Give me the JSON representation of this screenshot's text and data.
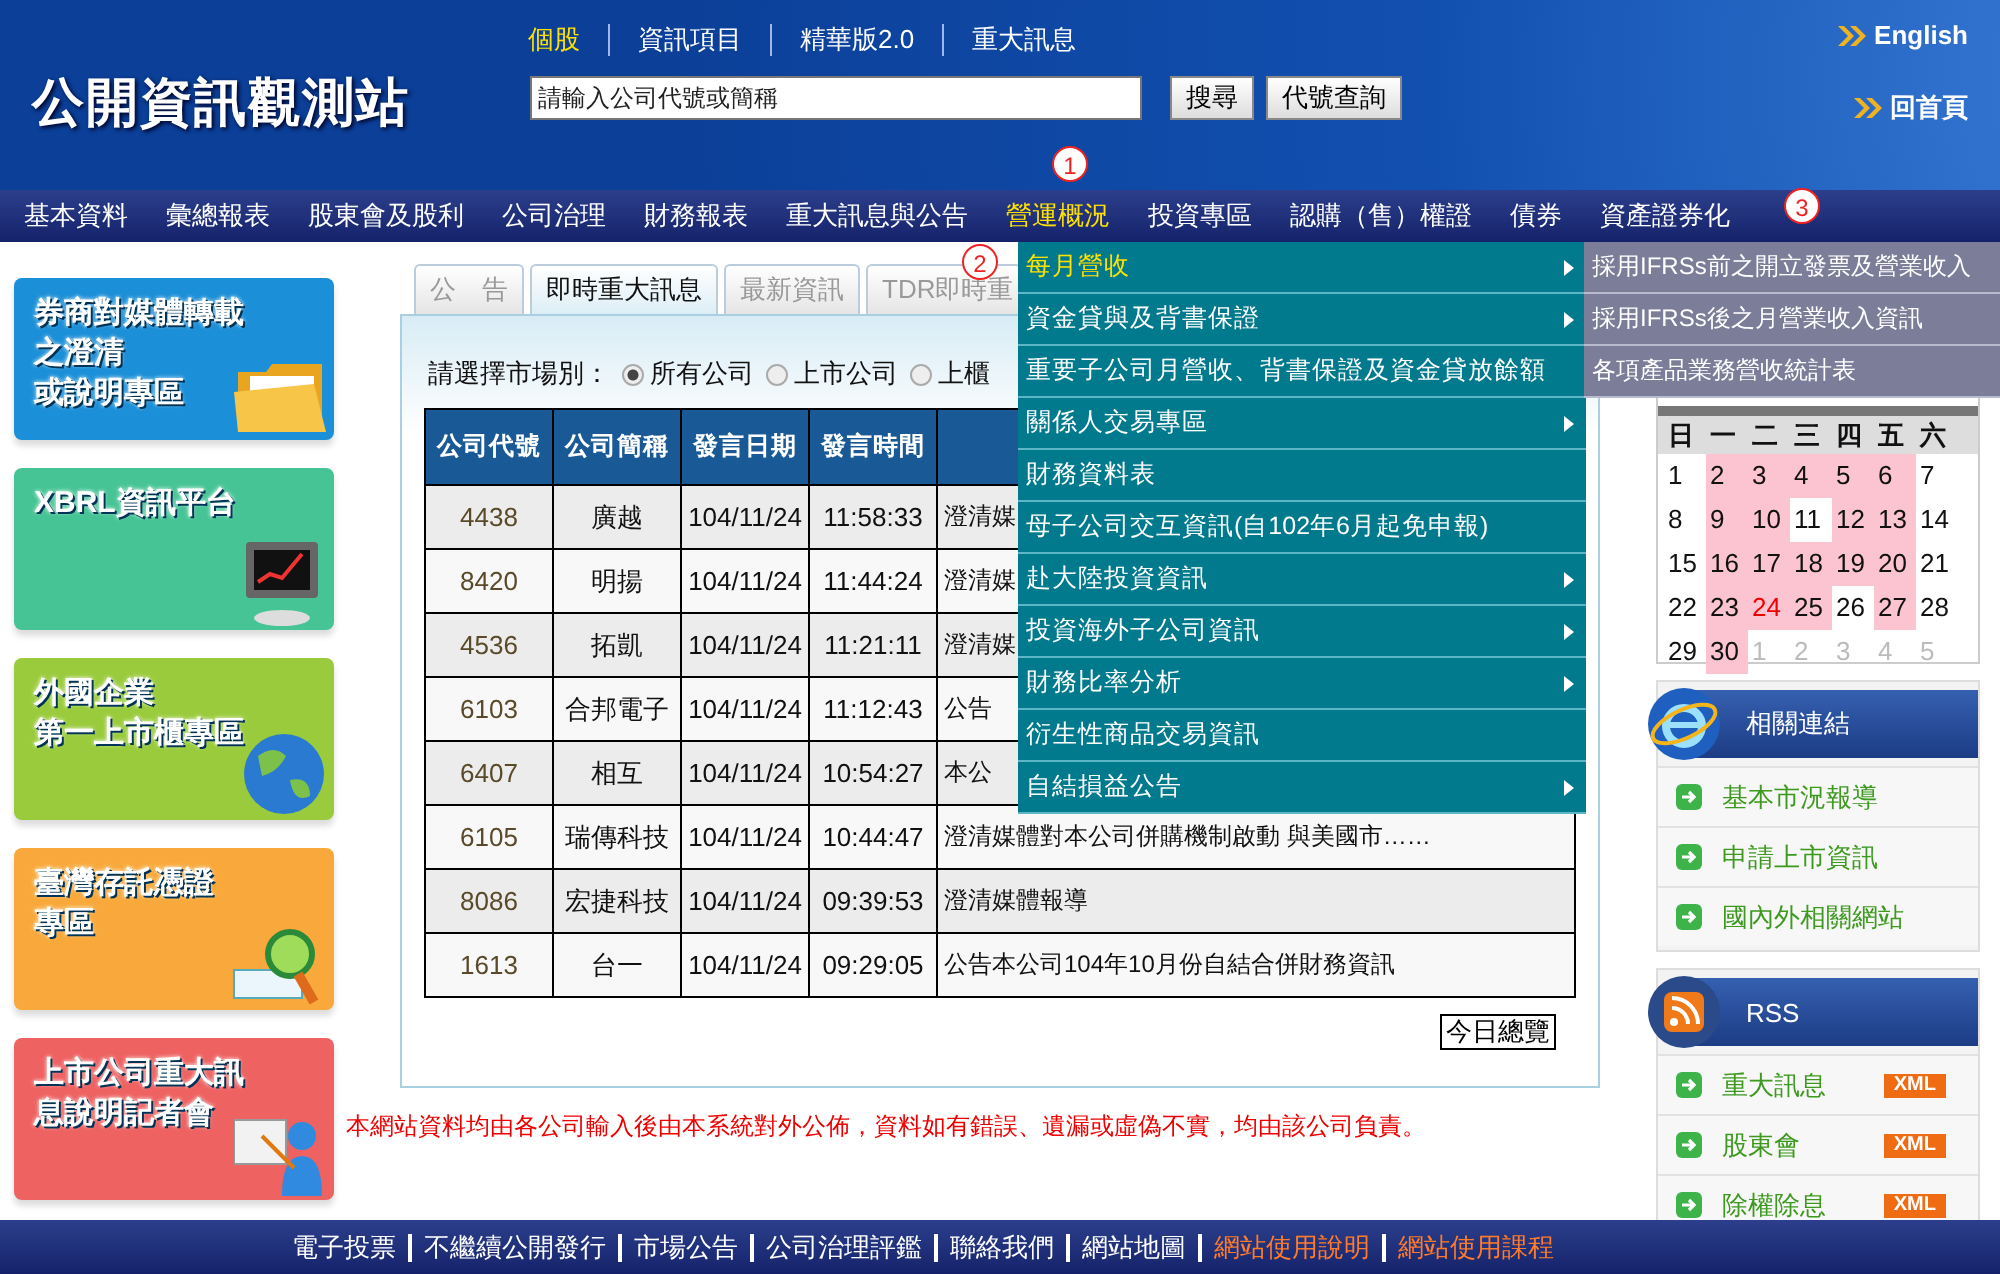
{
  "header": {
    "logo": "公開資訊觀測站",
    "top_links": [
      {
        "label": "個股",
        "selected": true
      },
      {
        "label": "資訊項目",
        "selected": false
      },
      {
        "label": "精華版2.0",
        "selected": false
      },
      {
        "label": "重大訊息",
        "selected": false
      }
    ],
    "search": {
      "placeholder": "請輸入公司代號或簡稱"
    },
    "buttons": [
      "搜尋",
      "代號查詢"
    ],
    "right_links": [
      "English",
      "回首頁"
    ]
  },
  "nav": [
    {
      "label": "基本資料",
      "selected": false
    },
    {
      "label": "彙總報表",
      "selected": false
    },
    {
      "label": "股東會及股利",
      "selected": false
    },
    {
      "label": "公司治理",
      "selected": false
    },
    {
      "label": "財務報表",
      "selected": false
    },
    {
      "label": "重大訊息與公告",
      "selected": false
    },
    {
      "label": "營運概況",
      "selected": true
    },
    {
      "label": "投資專區",
      "selected": false
    },
    {
      "label": "認購（售）權證",
      "selected": false
    },
    {
      "label": "債券",
      "selected": false
    },
    {
      "label": "資產證券化",
      "selected": false
    }
  ],
  "dropdown": [
    {
      "label": "每月營收",
      "selected": true,
      "has_submenu": true
    },
    {
      "label": "資金貸與及背書保證",
      "selected": false,
      "has_submenu": true
    },
    {
      "label": "重要子公司月營收、背書保證及資金貸放餘額",
      "selected": false,
      "has_submenu": false
    },
    {
      "label": "關係人交易專區",
      "selected": false,
      "has_submenu": true
    },
    {
      "label": "財務資料表",
      "selected": false,
      "has_submenu": false
    },
    {
      "label": "母子公司交互資訊(自102年6月起免申報)",
      "selected": false,
      "has_submenu": false
    },
    {
      "label": "赴大陸投資資訊",
      "selected": false,
      "has_submenu": true
    },
    {
      "label": "投資海外子公司資訊",
      "selected": false,
      "has_submenu": true
    },
    {
      "label": "財務比率分析",
      "selected": false,
      "has_submenu": true
    },
    {
      "label": "衍生性商品交易資訊",
      "selected": false,
      "has_submenu": false
    },
    {
      "label": "自結損益公告",
      "selected": false,
      "has_submenu": true
    }
  ],
  "submenu": [
    "採用IFRSs前之開立發票及營業收入",
    "採用IFRSs後之月營業收入資訊",
    "各項產品業務營收統計表"
  ],
  "markers": [
    "1",
    "2",
    "3"
  ],
  "banners": [
    {
      "lines": [
        "券商對媒體轉載",
        "之澄清",
        "或說明專區"
      ],
      "color": "#1b8fd8"
    },
    {
      "lines": [
        "XBRL資訊平台"
      ],
      "color": "#46c496"
    },
    {
      "lines": [
        "外國企業",
        "第一上市櫃專區"
      ],
      "color": "#9acb3c"
    },
    {
      "lines": [
        "臺灣存託憑證",
        "專區"
      ],
      "color": "#f9a93b"
    },
    {
      "lines": [
        "上市公司重大訊",
        "息說明記者會"
      ],
      "color": "#ee6262"
    }
  ],
  "tabs": [
    {
      "label": "公　告",
      "selected": false
    },
    {
      "label": "即時重大訊息",
      "selected": true
    },
    {
      "label": "最新資訊",
      "selected": false
    },
    {
      "label": "TDR即時重",
      "selected": false
    }
  ],
  "market": {
    "label": "請選擇市場別：",
    "options": [
      {
        "label": "所有公司",
        "selected": true
      },
      {
        "label": "上市公司",
        "selected": false
      },
      {
        "label": "上櫃",
        "selected": false
      }
    ]
  },
  "table": {
    "columns": [
      "公司代號",
      "公司簡稱",
      "發言日期",
      "發言時間"
    ],
    "rows": [
      [
        "4438",
        "廣越",
        "104/11/24",
        "11:58:33",
        "澄清媒"
      ],
      [
        "8420",
        "明揚",
        "104/11/24",
        "11:44:24",
        "澄清媒"
      ],
      [
        "4536",
        "拓凱",
        "104/11/24",
        "11:21:11",
        "澄清媒"
      ],
      [
        "6103",
        "合邦電子",
        "104/11/24",
        "11:12:43",
        "公告"
      ],
      [
        "6407",
        "相互",
        "104/11/24",
        "10:54:27",
        "本公"
      ],
      [
        "6105",
        "瑞傳科技",
        "104/11/24",
        "10:44:47",
        "澄清媒體對本公司併購機制啟動 與美國市……"
      ],
      [
        "8086",
        "宏捷科技",
        "104/11/24",
        "09:39:53",
        "澄清媒體報導"
      ],
      [
        "1613",
        "台一",
        "104/11/24",
        "09:29:05",
        "公告本公司104年10月份自結合併財務資訊"
      ]
    ]
  },
  "overview_button": "今日總覽",
  "disclaimer": "本網站資料均由各公司輸入後由本系統對外公佈，資料如有錯誤、遺漏或虛偽不實，均由該公司負責。",
  "calendar": {
    "weekdays": [
      "日",
      "一",
      "二",
      "三",
      "四",
      "五",
      "六"
    ],
    "days": [
      {
        "day": "1",
        "marked": false,
        "today": false,
        "other_month": false
      },
      {
        "day": "2",
        "marked": true,
        "today": false,
        "other_month": false
      },
      {
        "day": "3",
        "marked": true,
        "today": false,
        "other_month": false
      },
      {
        "day": "4",
        "marked": true,
        "today": false,
        "other_month": false
      },
      {
        "day": "5",
        "marked": true,
        "today": false,
        "other_month": false
      },
      {
        "day": "6",
        "marked": true,
        "today": false,
        "other_month": false
      },
      {
        "day": "7",
        "marked": false,
        "today": false,
        "other_month": false
      },
      {
        "day": "8",
        "marked": false,
        "today": false,
        "other_month": false
      },
      {
        "day": "9",
        "marked": true,
        "today": false,
        "other_month": false
      },
      {
        "day": "10",
        "marked": true,
        "today": false,
        "other_month": false
      },
      {
        "day": "11",
        "marked": false,
        "today": false,
        "other_month": false
      },
      {
        "day": "12",
        "marked": true,
        "today": false,
        "other_month": false
      },
      {
        "day": "13",
        "marked": true,
        "today": false,
        "other_month": false
      },
      {
        "day": "14",
        "marked": false,
        "today": false,
        "other_month": false
      },
      {
        "day": "15",
        "marked": false,
        "today": false,
        "other_month": false
      },
      {
        "day": "16",
        "marked": true,
        "today": false,
        "other_month": false
      },
      {
        "day": "17",
        "marked": true,
        "today": false,
        "other_month": false
      },
      {
        "day": "18",
        "marked": true,
        "today": false,
        "other_month": false
      },
      {
        "day": "19",
        "marked": true,
        "today": false,
        "other_month": false
      },
      {
        "day": "20",
        "marked": true,
        "today": false,
        "other_month": false
      },
      {
        "day": "21",
        "marked": false,
        "today": false,
        "other_month": false
      },
      {
        "day": "22",
        "marked": false,
        "today": false,
        "other_month": false
      },
      {
        "day": "23",
        "marked": true,
        "today": false,
        "other_month": false
      },
      {
        "day": "24",
        "marked": true,
        "today": true,
        "other_month": false
      },
      {
        "day": "25",
        "marked": true,
        "today": false,
        "other_month": false
      },
      {
        "day": "26",
        "marked": false,
        "today": false,
        "other_month": false
      },
      {
        "day": "27",
        "marked": true,
        "today": false,
        "other_month": false
      },
      {
        "day": "28",
        "marked": false,
        "today": false,
        "other_month": false
      },
      {
        "day": "29",
        "marked": false,
        "today": false,
        "other_month": false
      },
      {
        "day": "30",
        "marked": true,
        "today": false,
        "other_month": false
      },
      {
        "day": "1",
        "marked": false,
        "today": false,
        "other_month": true
      },
      {
        "day": "2",
        "marked": false,
        "today": false,
        "other_month": true
      },
      {
        "day": "3",
        "marked": false,
        "today": false,
        "other_month": true
      },
      {
        "day": "4",
        "marked": false,
        "today": false,
        "other_month": true
      },
      {
        "day": "5",
        "marked": false,
        "today": false,
        "other_month": true
      }
    ]
  },
  "related": {
    "title": "相關連結",
    "links": [
      "基本市況報導",
      "申請上市資訊",
      "國內外相關網站"
    ]
  },
  "rss": {
    "title": "RSS",
    "items": [
      {
        "label": "重大訊息",
        "badge": "XML"
      },
      {
        "label": "股東會",
        "badge": "XML"
      },
      {
        "label": "除權除息",
        "badge": "XML"
      }
    ]
  },
  "footer": [
    {
      "label": "電子投票",
      "highlight": false
    },
    {
      "label": "不繼續公開發行",
      "highlight": false
    },
    {
      "label": "市場公告",
      "highlight": false
    },
    {
      "label": "公司治理評鑑",
      "highlight": false
    },
    {
      "label": "聯絡我們",
      "highlight": false
    },
    {
      "label": "網站地圖",
      "highlight": false
    },
    {
      "label": "網站使用說明",
      "highlight": true
    },
    {
      "label": "網站使用課程",
      "highlight": true
    }
  ]
}
